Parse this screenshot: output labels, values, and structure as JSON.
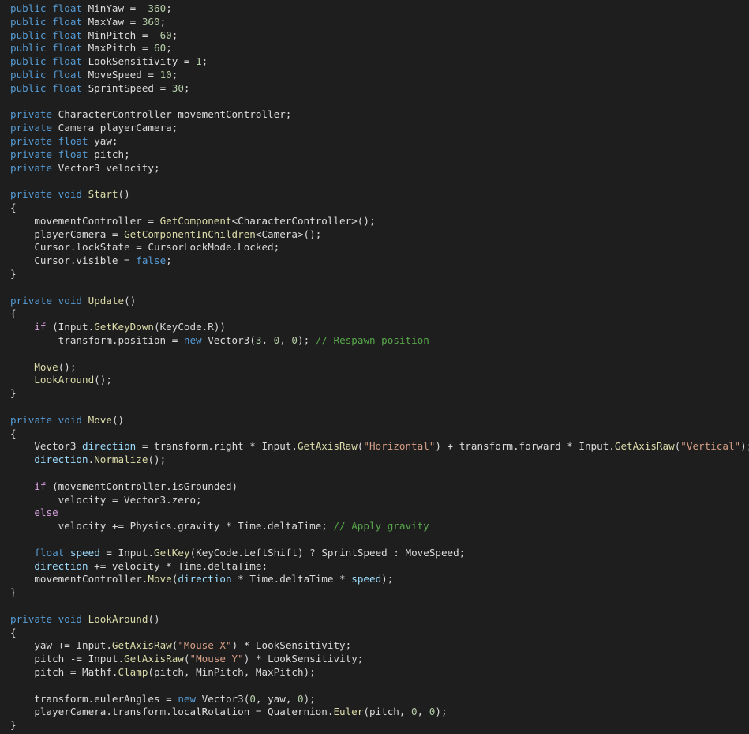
{
  "editor": {
    "language": "C#",
    "colors": {
      "background": "#1e1e1e",
      "keyword": "#569cd6",
      "control": "#d8a0df",
      "method": "#dcdcaa",
      "number": "#b5cea8",
      "string": "#d69d85",
      "comment": "#57a64a",
      "local": "#9cdcfe",
      "text": "#dcdcdc"
    },
    "lines": [
      [
        [
          "kw",
          "public"
        ],
        [
          "t",
          " "
        ],
        [
          "kw",
          "float"
        ],
        [
          "t",
          " MinYaw = "
        ],
        [
          "num",
          "-360"
        ],
        [
          "t",
          ";"
        ]
      ],
      [
        [
          "kw",
          "public"
        ],
        [
          "t",
          " "
        ],
        [
          "kw",
          "float"
        ],
        [
          "t",
          " MaxYaw = "
        ],
        [
          "num",
          "360"
        ],
        [
          "t",
          ";"
        ]
      ],
      [
        [
          "kw",
          "public"
        ],
        [
          "t",
          " "
        ],
        [
          "kw",
          "float"
        ],
        [
          "t",
          " MinPitch = "
        ],
        [
          "num",
          "-60"
        ],
        [
          "t",
          ";"
        ]
      ],
      [
        [
          "kw",
          "public"
        ],
        [
          "t",
          " "
        ],
        [
          "kw",
          "float"
        ],
        [
          "t",
          " MaxPitch = "
        ],
        [
          "num",
          "60"
        ],
        [
          "t",
          ";"
        ]
      ],
      [
        [
          "kw",
          "public"
        ],
        [
          "t",
          " "
        ],
        [
          "kw",
          "float"
        ],
        [
          "t",
          " LookSensitivity = "
        ],
        [
          "num",
          "1"
        ],
        [
          "t",
          ";"
        ]
      ],
      [
        [
          "kw",
          "public"
        ],
        [
          "t",
          " "
        ],
        [
          "kw",
          "float"
        ],
        [
          "t",
          " MoveSpeed = "
        ],
        [
          "num",
          "10"
        ],
        [
          "t",
          ";"
        ]
      ],
      [
        [
          "kw",
          "public"
        ],
        [
          "t",
          " "
        ],
        [
          "kw",
          "float"
        ],
        [
          "t",
          " SprintSpeed = "
        ],
        [
          "num",
          "30"
        ],
        [
          "t",
          ";"
        ]
      ],
      [],
      [
        [
          "kw",
          "private"
        ],
        [
          "t",
          " CharacterController movementController;"
        ]
      ],
      [
        [
          "kw",
          "private"
        ],
        [
          "t",
          " Camera playerCamera;"
        ]
      ],
      [
        [
          "kw",
          "private"
        ],
        [
          "t",
          " "
        ],
        [
          "kw",
          "float"
        ],
        [
          "t",
          " yaw;"
        ]
      ],
      [
        [
          "kw",
          "private"
        ],
        [
          "t",
          " "
        ],
        [
          "kw",
          "float"
        ],
        [
          "t",
          " pitch;"
        ]
      ],
      [
        [
          "kw",
          "private"
        ],
        [
          "t",
          " Vector3 velocity;"
        ]
      ],
      [],
      [
        [
          "kw",
          "private"
        ],
        [
          "t",
          " "
        ],
        [
          "kw",
          "void"
        ],
        [
          "t",
          " "
        ],
        [
          "fn",
          "Start"
        ],
        [
          "t",
          "()"
        ]
      ],
      [
        [
          "t",
          "{"
        ]
      ],
      [
        [
          "t",
          "    movementController = "
        ],
        [
          "fn",
          "GetComponent"
        ],
        [
          "t",
          "<CharacterController>();"
        ]
      ],
      [
        [
          "t",
          "    playerCamera = "
        ],
        [
          "fn",
          "GetComponentInChildren"
        ],
        [
          "t",
          "<Camera>();"
        ]
      ],
      [
        [
          "t",
          "    Cursor.lockState = CursorLockMode.Locked;"
        ]
      ],
      [
        [
          "t",
          "    Cursor.visible = "
        ],
        [
          "kw",
          "false"
        ],
        [
          "t",
          ";"
        ]
      ],
      [
        [
          "t",
          "}"
        ]
      ],
      [],
      [
        [
          "kw",
          "private"
        ],
        [
          "t",
          " "
        ],
        [
          "kw",
          "void"
        ],
        [
          "t",
          " "
        ],
        [
          "fn",
          "Update"
        ],
        [
          "t",
          "()"
        ]
      ],
      [
        [
          "t",
          "{"
        ]
      ],
      [
        [
          "t",
          "    "
        ],
        [
          "ctl",
          "if"
        ],
        [
          "t",
          " (Input."
        ],
        [
          "fn",
          "GetKeyDown"
        ],
        [
          "t",
          "(KeyCode.R))"
        ]
      ],
      [
        [
          "t",
          "        transform.position = "
        ],
        [
          "kw",
          "new"
        ],
        [
          "t",
          " Vector3("
        ],
        [
          "num",
          "3"
        ],
        [
          "t",
          ", "
        ],
        [
          "num",
          "0"
        ],
        [
          "t",
          ", "
        ],
        [
          "num",
          "0"
        ],
        [
          "t",
          ");"
        ],
        [
          "t",
          " "
        ],
        [
          "com",
          "// Respawn position"
        ]
      ],
      [],
      [
        [
          "t",
          "    "
        ],
        [
          "fn",
          "Move"
        ],
        [
          "t",
          "();"
        ]
      ],
      [
        [
          "t",
          "    "
        ],
        [
          "fn",
          "LookAround"
        ],
        [
          "t",
          "();"
        ]
      ],
      [
        [
          "t",
          "}"
        ]
      ],
      [],
      [
        [
          "kw",
          "private"
        ],
        [
          "t",
          " "
        ],
        [
          "kw",
          "void"
        ],
        [
          "t",
          " "
        ],
        [
          "fn",
          "Move"
        ],
        [
          "t",
          "()"
        ]
      ],
      [
        [
          "t",
          "{"
        ]
      ],
      [
        [
          "t",
          "    Vector3 "
        ],
        [
          "loc",
          "direction"
        ],
        [
          "t",
          " = transform.right * Input."
        ],
        [
          "fn",
          "GetAxisRaw"
        ],
        [
          "t",
          "("
        ],
        [
          "str",
          "\"Horizontal\""
        ],
        [
          "t",
          ") + transform.forward * Input."
        ],
        [
          "fn",
          "GetAxisRaw"
        ],
        [
          "t",
          "("
        ],
        [
          "str",
          "\"Vertical\""
        ],
        [
          "t",
          ");"
        ]
      ],
      [
        [
          "t",
          "    "
        ],
        [
          "loc",
          "direction"
        ],
        [
          "t",
          "."
        ],
        [
          "fn",
          "Normalize"
        ],
        [
          "t",
          "();"
        ]
      ],
      [],
      [
        [
          "t",
          "    "
        ],
        [
          "ctl",
          "if"
        ],
        [
          "t",
          " (movementController.isGrounded)"
        ]
      ],
      [
        [
          "t",
          "        velocity = Vector3.zero;"
        ]
      ],
      [
        [
          "t",
          "    "
        ],
        [
          "ctl",
          "else"
        ]
      ],
      [
        [
          "t",
          "        velocity += Physics.gravity * Time.deltaTime;"
        ],
        [
          "t",
          " "
        ],
        [
          "com",
          "// Apply gravity"
        ]
      ],
      [],
      [
        [
          "t",
          "    "
        ],
        [
          "kw",
          "float"
        ],
        [
          "t",
          " "
        ],
        [
          "loc",
          "speed"
        ],
        [
          "t",
          " = Input."
        ],
        [
          "fn",
          "GetKey"
        ],
        [
          "t",
          "(KeyCode.LeftShift) ? SprintSpeed : MoveSpeed;"
        ]
      ],
      [
        [
          "t",
          "    "
        ],
        [
          "loc",
          "direction"
        ],
        [
          "t",
          " += velocity * Time.deltaTime;"
        ]
      ],
      [
        [
          "t",
          "    movementController."
        ],
        [
          "fn",
          "Move"
        ],
        [
          "t",
          "("
        ],
        [
          "loc",
          "direction"
        ],
        [
          "t",
          " * Time.deltaTime * "
        ],
        [
          "loc",
          "speed"
        ],
        [
          "t",
          ");"
        ]
      ],
      [
        [
          "t",
          "}"
        ]
      ],
      [],
      [
        [
          "kw",
          "private"
        ],
        [
          "t",
          " "
        ],
        [
          "kw",
          "void"
        ],
        [
          "t",
          " "
        ],
        [
          "fn",
          "LookAround"
        ],
        [
          "t",
          "()"
        ]
      ],
      [
        [
          "t",
          "{"
        ]
      ],
      [
        [
          "t",
          "    yaw += Input."
        ],
        [
          "fn",
          "GetAxisRaw"
        ],
        [
          "t",
          "("
        ],
        [
          "str",
          "\"Mouse X\""
        ],
        [
          "t",
          ") * LookSensitivity;"
        ]
      ],
      [
        [
          "t",
          "    pitch -= Input."
        ],
        [
          "fn",
          "GetAxisRaw"
        ],
        [
          "t",
          "("
        ],
        [
          "str",
          "\"Mouse Y\""
        ],
        [
          "t",
          ") * LookSensitivity;"
        ]
      ],
      [
        [
          "t",
          "    pitch = Mathf."
        ],
        [
          "fn",
          "Clamp"
        ],
        [
          "t",
          "(pitch, MinPitch, MaxPitch);"
        ]
      ],
      [],
      [
        [
          "t",
          "    transform.eulerAngles = "
        ],
        [
          "kw",
          "new"
        ],
        [
          "t",
          " Vector3("
        ],
        [
          "num",
          "0"
        ],
        [
          "t",
          ", yaw, "
        ],
        [
          "num",
          "0"
        ],
        [
          "t",
          ");"
        ]
      ],
      [
        [
          "t",
          "    playerCamera.transform.localRotation = Quaternion."
        ],
        [
          "fn",
          "Euler"
        ],
        [
          "t",
          "(pitch, "
        ],
        [
          "num",
          "0"
        ],
        [
          "t",
          ", "
        ],
        [
          "num",
          "0"
        ],
        [
          "t",
          ");"
        ]
      ],
      [
        [
          "t",
          "}"
        ]
      ]
    ]
  }
}
